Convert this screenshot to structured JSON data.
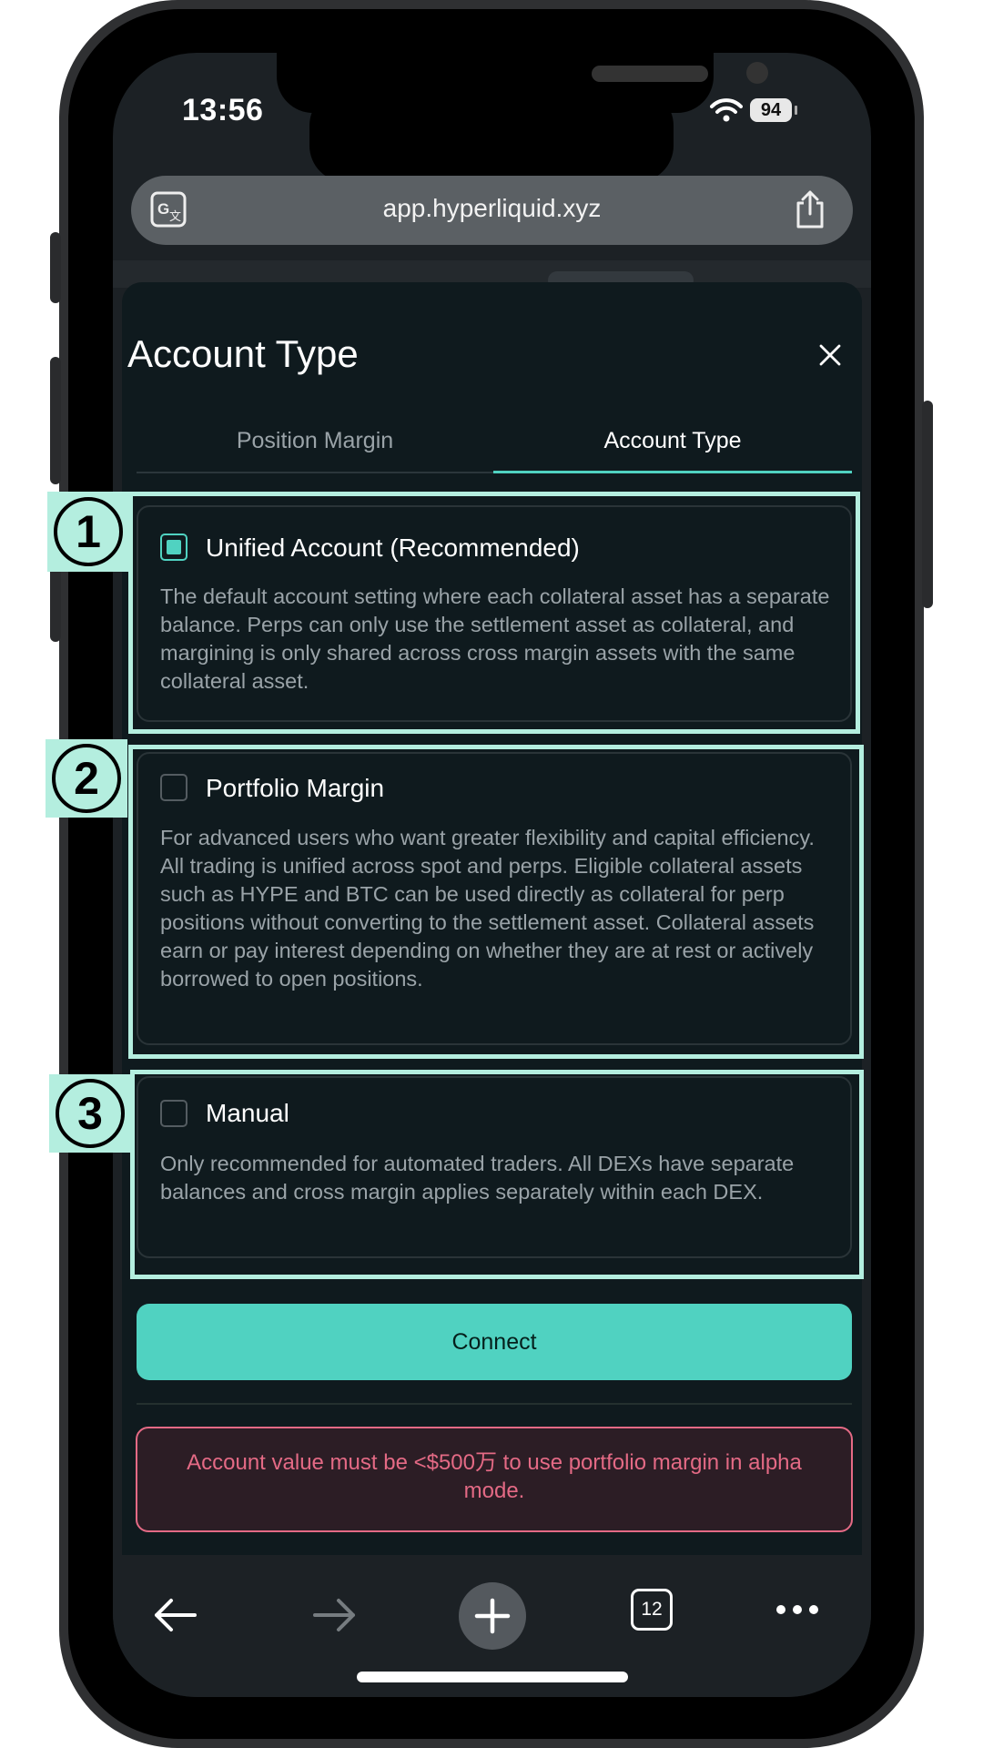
{
  "status_bar": {
    "time": "13:56",
    "battery": "94"
  },
  "browser": {
    "url": "app.hyperliquid.xyz",
    "tabs_count": "12"
  },
  "sheet": {
    "title": "Account Type",
    "tabs": [
      {
        "label": "Position Margin",
        "active": false
      },
      {
        "label": "Account Type",
        "active": true
      }
    ],
    "options": [
      {
        "title": "Unified Account (Recommended)",
        "checked": true,
        "description": "The default account setting where each collateral asset has a separate balance. Perps can only use the settlement asset as collateral, and margining is only shared across cross margin assets with the same collateral asset."
      },
      {
        "title": "Portfolio Margin",
        "checked": false,
        "description": "For advanced users who want greater flexibility and capital efficiency. All trading is unified across spot and perps. Eligible collateral assets such as HYPE and BTC can be used directly as collateral for perp positions without converting to the settlement asset. Collateral assets earn or pay interest depending on whether they are at rest or actively borrowed to open positions."
      },
      {
        "title": "Manual",
        "checked": false,
        "description": "Only recommended for automated traders. All DEXs have separate balances and cross margin applies separately within each DEX."
      }
    ],
    "connect_label": "Connect",
    "warning": "Account value must be <$500万 to use portfolio margin in alpha mode."
  },
  "annotations": [
    "①",
    "②",
    "③"
  ],
  "colors": {
    "accent": "#50d2c1",
    "highlight": "#b4eedf",
    "warning": "#e46a85",
    "background": "#0f1a1e"
  }
}
